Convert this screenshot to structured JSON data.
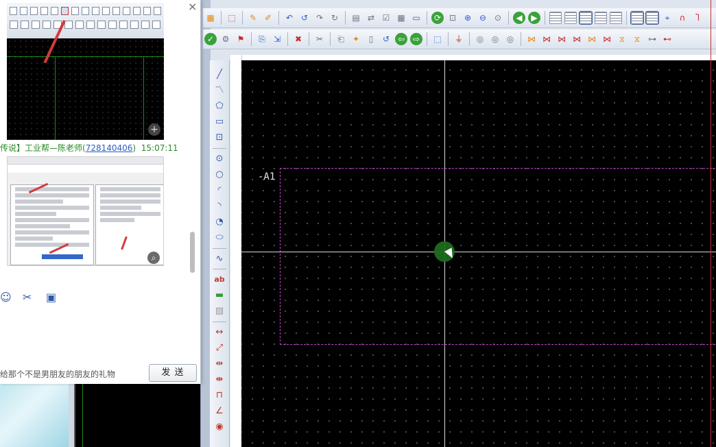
{
  "chat": {
    "meta_prefix": "传说】",
    "meta_sender": "工业帮—陈老师(",
    "meta_id": "728140406",
    "meta_suffix": ")",
    "meta_time": "15:07:11",
    "input_text": "给那个不是男朋友的朋友的礼物",
    "send_label": "发 送",
    "close_label": "×"
  },
  "canvas": {
    "frame_label": "-A1"
  },
  "icons": {
    "emoji": "emoji-icon",
    "scissors": "scissors-icon",
    "image": "image-icon"
  },
  "colors": {
    "canvas_bg": "#000000",
    "frame_dash": "#c045c9",
    "crosshair": "#d9d9d9",
    "cursor_dot": "#1d6b1d"
  }
}
